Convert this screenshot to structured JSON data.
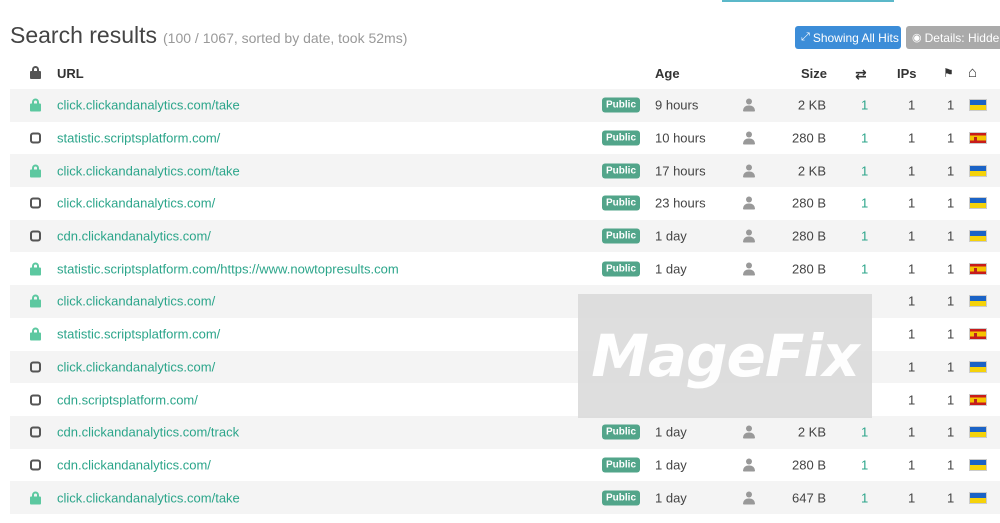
{
  "header": {
    "title": "Search results",
    "meta": "(100 / 1067, sorted by date, took 52ms)"
  },
  "toolbar": {
    "showing_all_hits": "Showing All Hits",
    "details_hidden": "Details: Hidden"
  },
  "table": {
    "columns": {
      "url": "URL",
      "age": "Age",
      "size": "Size",
      "ips": "IPs"
    },
    "rows": [
      {
        "lock": "locked",
        "url": "click.clickandanalytics.com/take",
        "badge": "Public",
        "age": "9 hours",
        "size": "2 KB",
        "hits": "1",
        "ips": "1",
        "one": "1",
        "flag": "ua"
      },
      {
        "lock": "open",
        "url": "statistic.scriptsplatform.com/",
        "badge": "Public",
        "age": "10 hours",
        "size": "280 B",
        "hits": "1",
        "ips": "1",
        "one": "1",
        "flag": "es"
      },
      {
        "lock": "locked",
        "url": "click.clickandanalytics.com/take",
        "badge": "Public",
        "age": "17 hours",
        "size": "2 KB",
        "hits": "1",
        "ips": "1",
        "one": "1",
        "flag": "ua"
      },
      {
        "lock": "open",
        "url": "click.clickandanalytics.com/",
        "badge": "Public",
        "age": "23 hours",
        "size": "280 B",
        "hits": "1",
        "ips": "1",
        "one": "1",
        "flag": "ua"
      },
      {
        "lock": "open",
        "url": "cdn.clickandanalytics.com/",
        "badge": "Public",
        "age": "1 day",
        "size": "280 B",
        "hits": "1",
        "ips": "1",
        "one": "1",
        "flag": "ua"
      },
      {
        "lock": "locked",
        "url": "statistic.scriptsplatform.com/https://www.nowtopresults.com",
        "badge": "Public",
        "age": "1 day",
        "size": "280 B",
        "hits": "1",
        "ips": "1",
        "one": "1",
        "flag": "es"
      },
      {
        "lock": "locked",
        "url": "click.clickandanalytics.com/",
        "badge": "",
        "age": "",
        "size": "",
        "hits": "",
        "ips": "1",
        "one": "1",
        "flag": "ua"
      },
      {
        "lock": "locked",
        "url": "statistic.scriptsplatform.com/",
        "badge": "",
        "age": "",
        "size": "",
        "hits": "",
        "ips": "1",
        "one": "1",
        "flag": "es"
      },
      {
        "lock": "open",
        "url": "click.clickandanalytics.com/",
        "badge": "",
        "age": "",
        "size": "",
        "hits": "",
        "ips": "1",
        "one": "1",
        "flag": "ua"
      },
      {
        "lock": "open",
        "url": "cdn.scriptsplatform.com/",
        "badge": "",
        "age": "",
        "size": "",
        "hits": "",
        "ips": "1",
        "one": "1",
        "flag": "es"
      },
      {
        "lock": "open",
        "url": "cdn.clickandanalytics.com/track",
        "badge": "Public",
        "age": "1 day",
        "size": "2 KB",
        "hits": "1",
        "ips": "1",
        "one": "1",
        "flag": "ua"
      },
      {
        "lock": "open",
        "url": "cdn.clickandanalytics.com/",
        "badge": "Public",
        "age": "1 day",
        "size": "280 B",
        "hits": "1",
        "ips": "1",
        "one": "1",
        "flag": "ua"
      },
      {
        "lock": "locked",
        "url": "click.clickandanalytics.com/take",
        "badge": "Public",
        "age": "1 day",
        "size": "647 B",
        "hits": "1",
        "ips": "1",
        "one": "1",
        "flag": "ua"
      }
    ]
  },
  "watermark": {
    "text": "MageFix"
  },
  "colors": {
    "accent": "#2ba58a",
    "badge": "#52a58a",
    "button_blue": "#3c8dd8",
    "button_gray": "#aaaaaa"
  }
}
